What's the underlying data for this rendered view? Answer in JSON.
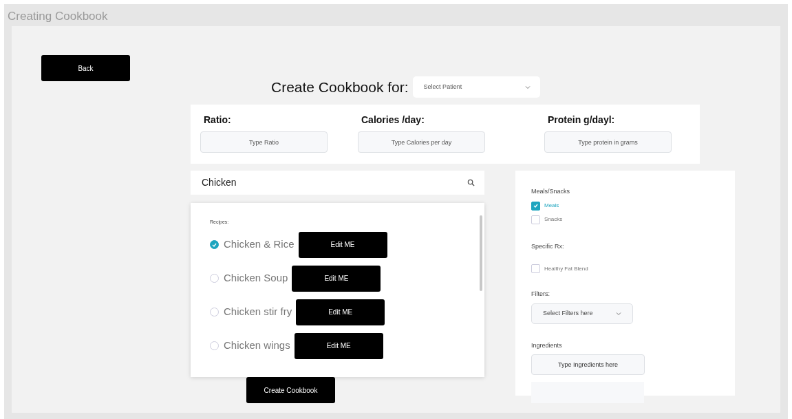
{
  "window": {
    "title": "Creating Cookbook"
  },
  "back_button": "Back",
  "heading": "Create Cookbook for:",
  "patient_select": {
    "placeholder": "Select Patient"
  },
  "params": [
    {
      "label": "Ratio:",
      "placeholder": "Type Ratio"
    },
    {
      "label": "Calories /day:",
      "placeholder": "Type Calories per day"
    },
    {
      "label": "Protein g/dayl:",
      "placeholder": "Type protein in grams"
    }
  ],
  "search": {
    "value": "Chicken"
  },
  "recipes": {
    "label": "Recipes:",
    "items": [
      {
        "name": "Chicken & Rice",
        "checked": true,
        "edit_button": "Edit ME"
      },
      {
        "name": "Chicken Soup",
        "checked": false,
        "edit_button": "Edit ME"
      },
      {
        "name": "Chicken stir fry",
        "checked": false,
        "edit_button": "Edit ME"
      },
      {
        "name": "Chicken wings",
        "checked": false,
        "edit_button": "Edit ME"
      }
    ]
  },
  "create_button": "Create Cookbook",
  "meal_types": {
    "label": "Meals/Snacks",
    "options": [
      {
        "label": "Meals",
        "checked": true
      },
      {
        "label": "Snacks",
        "checked": false
      }
    ]
  },
  "specific_rx": {
    "label": "Specific Rx:",
    "options": [
      {
        "label": "Healthy Fat Blend",
        "checked": false
      }
    ]
  },
  "filters": {
    "label": "Filters:",
    "placeholder": "Select Filters here"
  },
  "ingredients": {
    "label": "Ingredients",
    "placeholder": "Type Ingredients here"
  }
}
